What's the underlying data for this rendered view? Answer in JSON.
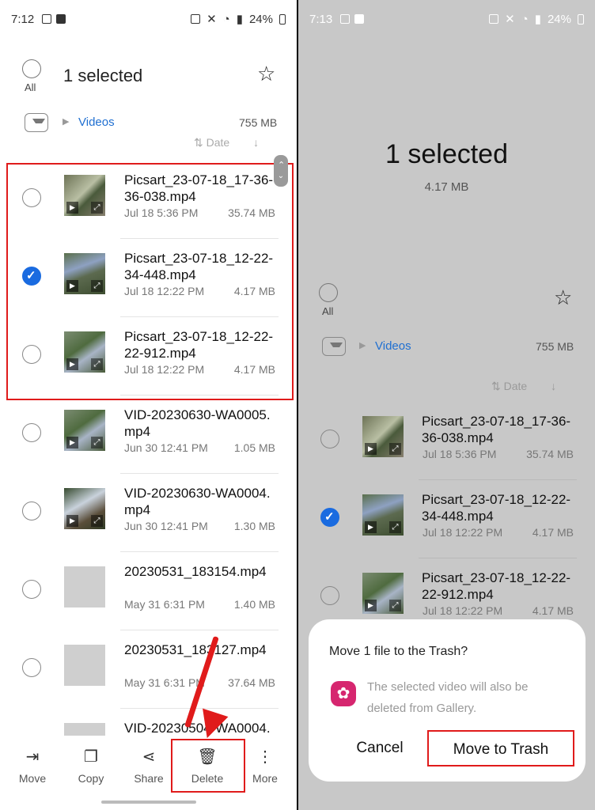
{
  "left": {
    "status": {
      "time": "7:12",
      "battery": "24%"
    },
    "header": {
      "all_label": "All",
      "title": "1 selected"
    },
    "path": {
      "folder": "Videos",
      "size": "755 MB"
    },
    "sort": {
      "label": "Date"
    },
    "files": [
      {
        "name": "Picsart_23-07-18_17-36-36-038.mp4",
        "date": "Jul 18 5:36 PM",
        "size": "35.74 MB",
        "checked": false
      },
      {
        "name": "Picsart_23-07-18_12-22-34-448.mp4",
        "date": "Jul 18 12:22 PM",
        "size": "4.17 MB",
        "checked": true
      },
      {
        "name": "Picsart_23-07-18_12-22-22-912.mp4",
        "date": "Jul 18 12:22 PM",
        "size": "4.17 MB",
        "checked": false
      },
      {
        "name": "VID-20230630-WA0005.mp4",
        "date": "Jun 30 12:41 PM",
        "size": "1.05 MB",
        "checked": false
      },
      {
        "name": "VID-20230630-WA0004.mp4",
        "date": "Jun 30 12:41 PM",
        "size": "1.30 MB",
        "checked": false
      },
      {
        "name": "20230531_183154.mp4",
        "date": "May 31 6:31 PM",
        "size": "1.40 MB",
        "checked": false
      },
      {
        "name": "20230531_183127.mp4",
        "date": "May 31 6:31 PM",
        "size": "37.64 MB",
        "checked": false
      },
      {
        "name": "VID-20230504-WA0004.",
        "date": "",
        "size": "",
        "checked": false
      }
    ],
    "bottom_bar": {
      "move": "Move",
      "copy": "Copy",
      "share": "Share",
      "delete": "Delete",
      "more": "More"
    }
  },
  "right": {
    "status": {
      "time": "7:13",
      "battery": "24%"
    },
    "big_title": "1 selected",
    "big_size": "4.17 MB",
    "header": {
      "all_label": "All"
    },
    "path": {
      "folder": "Videos",
      "size": "755 MB"
    },
    "sort": {
      "label": "Date"
    },
    "files": [
      {
        "name": "Picsart_23-07-18_17-36-36-038.mp4",
        "date": "Jul 18 5:36 PM",
        "size": "35.74 MB"
      },
      {
        "name": "Picsart_23-07-18_12-22-34-448.mp4",
        "date": "Jul 18 12:22 PM",
        "size": "4.17 MB"
      },
      {
        "name": "Picsart_23-07-18_12-22-22-912.mp4",
        "date": "Jul 18 12:22 PM",
        "size": "4.17 MB"
      }
    ],
    "dialog": {
      "title": "Move 1 file to the Trash?",
      "message": "The selected video will also be deleted from Gallery.",
      "cancel": "Cancel",
      "confirm": "Move to Trash"
    }
  },
  "colors": {
    "accent": "#1a6be0",
    "highlight": "#e01b1b",
    "folder_link": "#1f6fd1"
  }
}
